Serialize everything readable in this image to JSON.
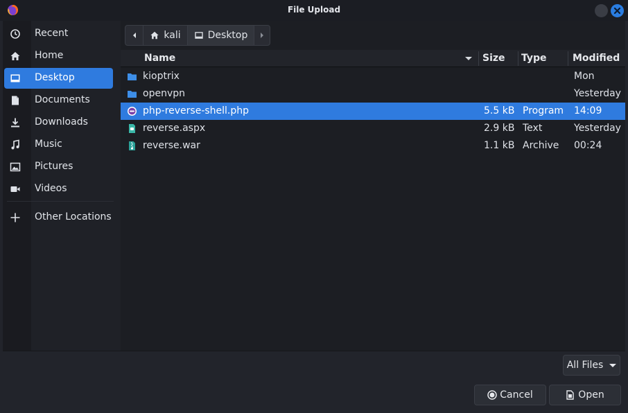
{
  "window": {
    "title": "File Upload",
    "app_icon": "firefox-icon"
  },
  "sidebar": {
    "items": [
      {
        "label": "Recent",
        "icon": "clock-icon",
        "active": false
      },
      {
        "label": "Home",
        "icon": "home-icon",
        "active": false
      },
      {
        "label": "Desktop",
        "icon": "desktop-icon",
        "active": true
      },
      {
        "label": "Documents",
        "icon": "document-icon",
        "active": false
      },
      {
        "label": "Downloads",
        "icon": "download-icon",
        "active": false
      },
      {
        "label": "Music",
        "icon": "music-icon",
        "active": false
      },
      {
        "label": "Pictures",
        "icon": "picture-icon",
        "active": false
      },
      {
        "label": "Videos",
        "icon": "video-icon",
        "active": false
      }
    ],
    "other": {
      "label": "Other Locations",
      "icon": "plus-icon"
    }
  },
  "pathbar": {
    "segments": [
      {
        "label": "kali",
        "icon": "home-icon"
      },
      {
        "label": "Desktop",
        "icon": "desktop-icon"
      }
    ]
  },
  "file_list": {
    "columns": {
      "name": "Name",
      "size": "Size",
      "type": "Type",
      "modified": "Modified"
    },
    "rows": [
      {
        "name": "kioptrix",
        "size": "",
        "type": "",
        "modified": "Mon",
        "icon": "folder-icon",
        "selected": false
      },
      {
        "name": "openvpn",
        "size": "",
        "type": "",
        "modified": "Yesterday",
        "icon": "folder-icon",
        "selected": false
      },
      {
        "name": "php-reverse-shell.php",
        "size": "5.5 kB",
        "type": "Program",
        "modified": "14:09",
        "icon": "php-file-icon",
        "selected": true
      },
      {
        "name": "reverse.aspx",
        "size": "2.9 kB",
        "type": "Text",
        "modified": "Yesterday",
        "icon": "text-file-icon",
        "selected": false
      },
      {
        "name": "reverse.war",
        "size": "1.1 kB",
        "type": "Archive",
        "modified": "00:24",
        "icon": "archive-file-icon",
        "selected": false
      }
    ]
  },
  "footer": {
    "filter": "All Files",
    "cancel": "Cancel",
    "open": "Open"
  },
  "colors": {
    "accent": "#2f7bdf",
    "folder": "#3d8ee8",
    "background": "#1c1e23"
  }
}
